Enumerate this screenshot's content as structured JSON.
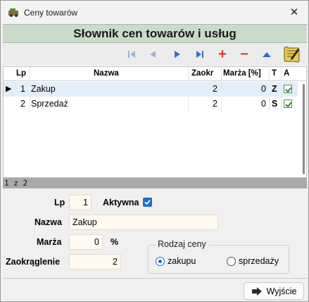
{
  "window": {
    "title": "Ceny towarów",
    "close_glyph": "✕"
  },
  "header": {
    "title": "Słownik cen towarów i usług"
  },
  "toolbar": {
    "buttons": [
      {
        "name": "first-record-icon"
      },
      {
        "name": "prev-record-icon"
      },
      {
        "name": "next-record-icon"
      },
      {
        "name": "last-record-icon"
      },
      {
        "name": "add-record-icon",
        "glyph": "+"
      },
      {
        "name": "delete-record-icon",
        "glyph": "−"
      },
      {
        "name": "edit-record-icon"
      },
      {
        "name": "note-edit-icon"
      }
    ]
  },
  "grid": {
    "columns": [
      "Lp",
      "Nazwa",
      "Zaokr",
      "Marża [%]",
      "T",
      "A"
    ],
    "rows": [
      {
        "lp": "1",
        "nazwa": "Zakup",
        "zaokr": "2",
        "marza": "0",
        "t": "Z",
        "a": true
      },
      {
        "lp": "2",
        "nazwa": "Sprzedaż",
        "zaokr": "2",
        "marza": "0",
        "t": "S",
        "a": true
      }
    ],
    "row_indicator": "▶"
  },
  "status": {
    "text": "1 z 2"
  },
  "form": {
    "lp_label": "Lp",
    "lp_value": "1",
    "aktywna_label": "Aktywna",
    "aktywna_checked": true,
    "nazwa_label": "Nazwa",
    "nazwa_value": "Zakup",
    "marza_label": "Marża",
    "marza_value": "0",
    "marza_unit": "%",
    "zaokr_label": "Zaokrąglenie",
    "zaokr_value": "2",
    "rodzaj_label": "Rodzaj ceny",
    "radio_zakupu": "zakupu",
    "radio_sprzedazy": "sprzedaży",
    "selected": "zakupu"
  },
  "footer": {
    "exit_label": "Wyjście"
  },
  "colors": {
    "accent": "#1f6fd0",
    "header_band": "#c9dcc9",
    "selected_row": "#e3eefb",
    "nav_blue": "#2f6fc8",
    "add_red": "#e03a2a"
  }
}
